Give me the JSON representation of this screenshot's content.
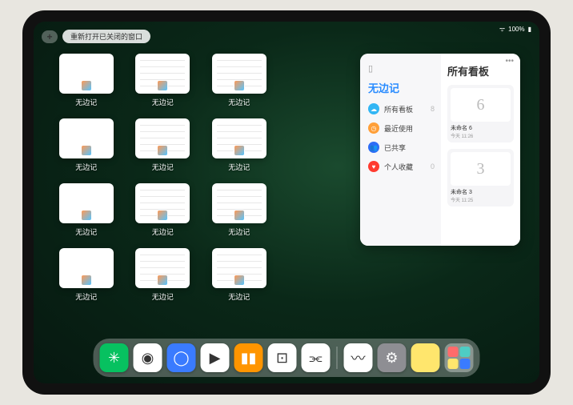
{
  "status": {
    "battery": "100%"
  },
  "topbar": {
    "plus": "+",
    "reopen": "重新打开已关闭的窗口"
  },
  "app_name": "无边记",
  "thumbnails": [
    {
      "label": "无边记",
      "variant": "blank"
    },
    {
      "label": "无边记",
      "variant": "content"
    },
    {
      "label": "无边记",
      "variant": "content"
    },
    {
      "label": "无边记",
      "variant": "blank"
    },
    {
      "label": "无边记",
      "variant": "content"
    },
    {
      "label": "无边记",
      "variant": "content"
    },
    {
      "label": "无边记",
      "variant": "blank"
    },
    {
      "label": "无边记",
      "variant": "content"
    },
    {
      "label": "无边记",
      "variant": "content"
    },
    {
      "label": "无边记",
      "variant": "blank"
    },
    {
      "label": "无边记",
      "variant": "content"
    },
    {
      "label": "无边记",
      "variant": "content"
    }
  ],
  "panel": {
    "left": {
      "title": "无边记",
      "items": [
        {
          "icon": "☁",
          "color": "#32b6f4",
          "label": "所有看板",
          "count": "8"
        },
        {
          "icon": "◷",
          "color": "#ff9f38",
          "label": "最近使用",
          "count": ""
        },
        {
          "icon": "👥",
          "color": "#2d6df6",
          "label": "已共享",
          "count": ""
        },
        {
          "icon": "♥",
          "color": "#ff3b30",
          "label": "个人收藏",
          "count": "0"
        }
      ]
    },
    "right": {
      "title": "所有看板",
      "boards": [
        {
          "glyph": "6",
          "name": "未命名 6",
          "date": "今天 11:26"
        },
        {
          "glyph": "3",
          "name": "未命名 3",
          "date": "今天 11:25"
        }
      ]
    }
  },
  "dock": [
    {
      "name": "wechat",
      "bg": "#07c160",
      "glyph": "✳"
    },
    {
      "name": "quark-blue",
      "bg": "#ffffff",
      "glyph": "◉"
    },
    {
      "name": "quark",
      "bg": "#3a7bff",
      "glyph": "◯"
    },
    {
      "name": "play",
      "bg": "#ffffff",
      "glyph": "▶"
    },
    {
      "name": "books",
      "bg": "#ff9500",
      "glyph": "▮▮"
    },
    {
      "name": "dice",
      "bg": "#ffffff",
      "glyph": "⊡"
    },
    {
      "name": "connect",
      "bg": "#ffffff",
      "glyph": "⫘"
    },
    {
      "name": "freeform",
      "bg": "#ffffff",
      "glyph": "〰"
    },
    {
      "name": "settings",
      "bg": "#8e8e93",
      "glyph": "⚙"
    },
    {
      "name": "notes",
      "bg": "#ffe66d",
      "glyph": ""
    }
  ]
}
